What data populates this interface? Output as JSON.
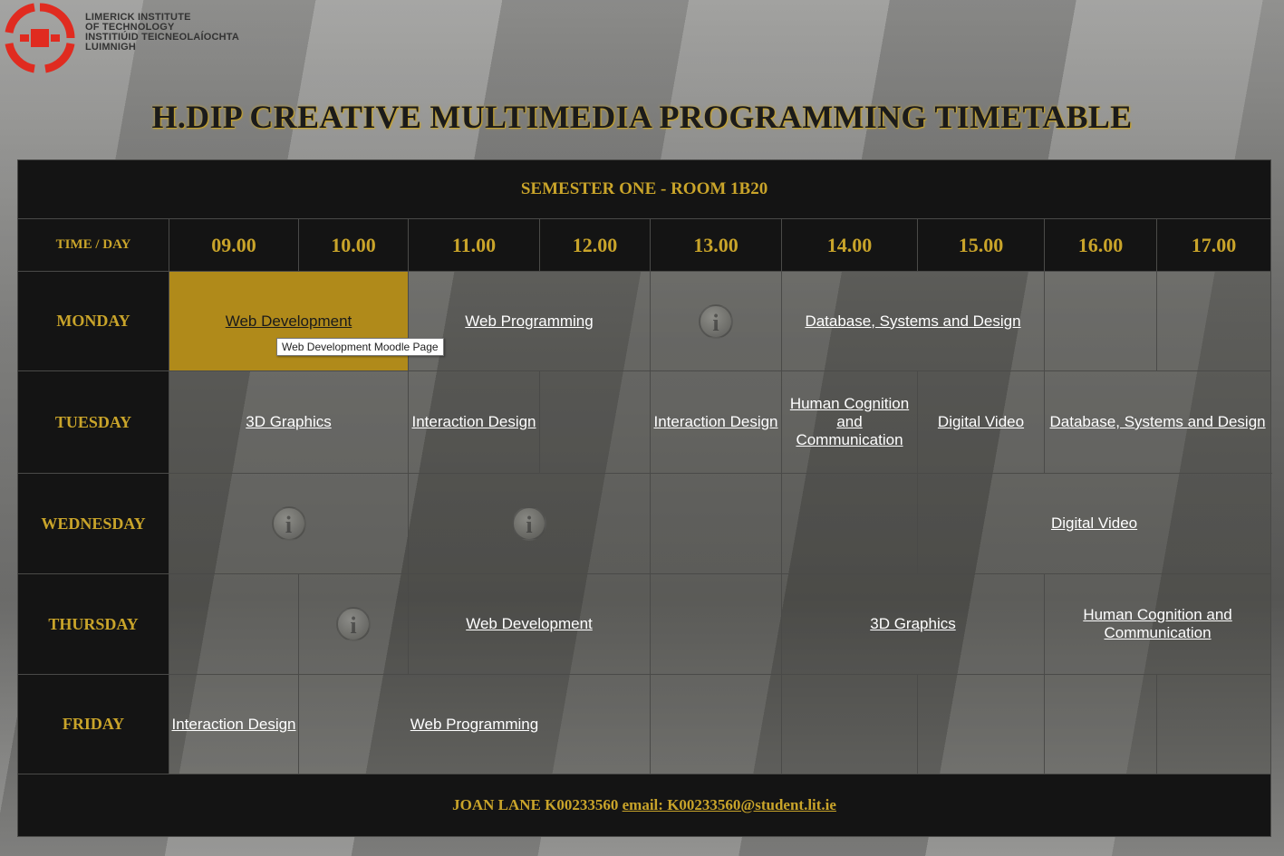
{
  "logo": {
    "line1": "LIMERICK INSTITUTE",
    "line2": "OF TECHNOLOGY",
    "line3": "INSTITIÚID TEICNEOLAÍOCHTA",
    "line4": "LUIMNIGH"
  },
  "title": "H.DIP CREATIVE MULTIMEDIA PROGRAMMING TIMETABLE",
  "semester": "SEMESTER ONE - ROOM 1B20",
  "time_day_label": "TIME / DAY",
  "hours": [
    "09.00",
    "10.00",
    "11.00",
    "12.00",
    "13.00",
    "14.00",
    "15.00",
    "16.00",
    "17.00"
  ],
  "days": {
    "monday": "MONDAY",
    "tuesday": "TUESDAY",
    "wednesday": "WEDNESDAY",
    "thursday": "THURSDAY",
    "friday": "FRIDAY"
  },
  "monday": {
    "web_development": "Web Development",
    "web_programming": "Web Programming",
    "database": "Database, Systems and Design"
  },
  "tuesday": {
    "graphics_3d": "3D Graphics",
    "interaction_design_1": "Interaction Design",
    "interaction_design_2": "Interaction Design",
    "human_cognition": "Human Cognition and Communication",
    "digital_video": "Digital Video",
    "database": "Database, Systems and Design"
  },
  "wednesday": {
    "digital_video": "Digital Video"
  },
  "thursday": {
    "web_development": "Web Development",
    "graphics_3d": "3D Graphics",
    "human_cognition": "Human Cognition and Communication"
  },
  "friday": {
    "interaction_design": "Interaction Design",
    "web_programming": "Web Programming"
  },
  "info_glyph": "i",
  "tooltip": "Web Development Moodle Page",
  "footer": {
    "name": "JOAN LANE K00233560",
    "email_label": "email: K00233560@student.lit.ie"
  },
  "colors": {
    "accent": "#c9a42a",
    "header_bg": "#141414",
    "highlight": "#b08a1a"
  }
}
